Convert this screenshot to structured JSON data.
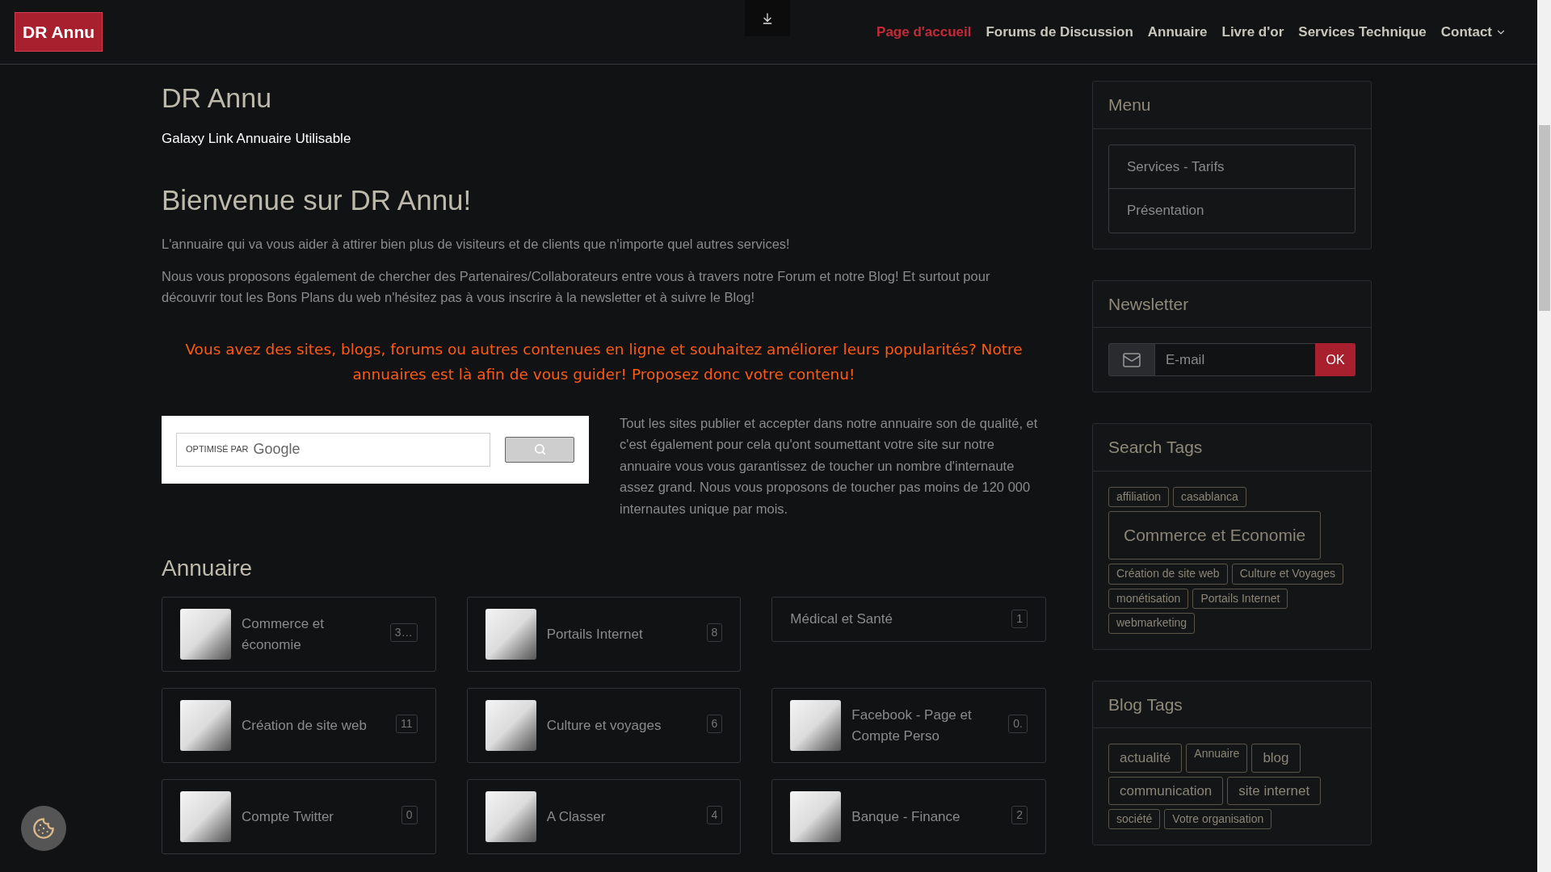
{
  "header": {
    "logo": "DR Annu",
    "nav": [
      {
        "label": "Page d'accueil",
        "selected": true,
        "dropdown": false
      },
      {
        "label": "Forums de Discussion",
        "selected": false,
        "dropdown": false
      },
      {
        "label": "Annuaire",
        "selected": false,
        "dropdown": false
      },
      {
        "label": "Livre d'or",
        "selected": false,
        "dropdown": false
      },
      {
        "label": "Services Technique",
        "selected": false,
        "dropdown": false
      },
      {
        "label": "Contact",
        "selected": false,
        "dropdown": true
      }
    ]
  },
  "main": {
    "site_title": "DR Annu",
    "tagline": "Galaxy Link Annuaire Utilisable",
    "heading": "Bienvenue sur DR Annu!",
    "paragraphs": [
      "L'annuaire qui va vous aider à attirer bien plus de visiteurs et de clients que n'importe quel autres services!",
      "Nous vous proposons également de chercher des Partenaires/Collaborateurs entre vous à travers notre Forum et notre Blog! Et surtout pour découvrir tout les Bons Plans du web n'hésitez pas à vous inscrire à la newsletter et à suivre le Blog!"
    ],
    "callout": "Vous avez des sites, blogs, forums ou autres contenues en ligne et souhaitez améliorer leurs popularités? Notre annuaires est là afin de vous guider! Proposez donc votre contenu!",
    "google_search": {
      "powered_by": "OPTIMISÉ PAR",
      "brand": "Google"
    },
    "side_text": "Tout les sites publier et accepter dans notre annuaire son de qualité, et c'est également pour cela qu'ont soumettant votre site sur notre annuaire vous vous garantissez de toucher un nombre d'internaute assez grand. Nous vous proposons de toucher pas moins de 120 000 internautes unique par mois."
  },
  "annuaire": {
    "title": "Annuaire",
    "categories": [
      {
        "name": "Commerce et économie",
        "count": "3…",
        "kind": "image"
      },
      {
        "name": "Portails Internet",
        "count": "8",
        "kind": "image"
      },
      {
        "name": "Médical et Santé",
        "count": "1",
        "kind": "text"
      },
      {
        "name": "Création de site web",
        "count": "11",
        "kind": "image"
      },
      {
        "name": "Culture et voyages",
        "count": "6",
        "kind": "image"
      },
      {
        "name": "Facebook - Page et Compte Perso",
        "count": "0.",
        "kind": "image"
      },
      {
        "name": "Compte Twitter",
        "count": "0",
        "kind": "image"
      },
      {
        "name": "A Classer",
        "count": "4",
        "kind": "image"
      },
      {
        "name": "Banque - Finance",
        "count": "2",
        "kind": "image"
      }
    ]
  },
  "sidebar": {
    "menu": {
      "title": "Menu",
      "items": [
        "Services - Tarifs",
        "Présentation"
      ]
    },
    "newsletter": {
      "title": "Newsletter",
      "placeholder": "E-mail",
      "button": "OK"
    },
    "search_tags": {
      "title": "Search Tags",
      "tags": [
        {
          "label": "affiliation",
          "kind": "small"
        },
        {
          "label": "casablanca",
          "kind": "small"
        },
        {
          "label": "Commerce et Economie",
          "kind": "large"
        },
        {
          "label": "Création de site web",
          "kind": "small"
        },
        {
          "label": "Culture et Voyages",
          "kind": "small"
        },
        {
          "label": "monétisation",
          "kind": "small"
        },
        {
          "label": "Portails Internet",
          "kind": "small"
        },
        {
          "label": "webmarketing",
          "kind": "small"
        }
      ]
    },
    "blog_tags": {
      "title": "Blog Tags",
      "tags": [
        {
          "label": "actualité",
          "kind": "medium"
        },
        {
          "label": "Annuaire",
          "kind": "small"
        },
        {
          "label": "blog",
          "kind": "medium"
        },
        {
          "label": "communication",
          "kind": "medium"
        },
        {
          "label": "site internet",
          "kind": "medium"
        },
        {
          "label": "société",
          "kind": "small"
        },
        {
          "label": "Votre organisation",
          "kind": "small"
        }
      ]
    }
  }
}
